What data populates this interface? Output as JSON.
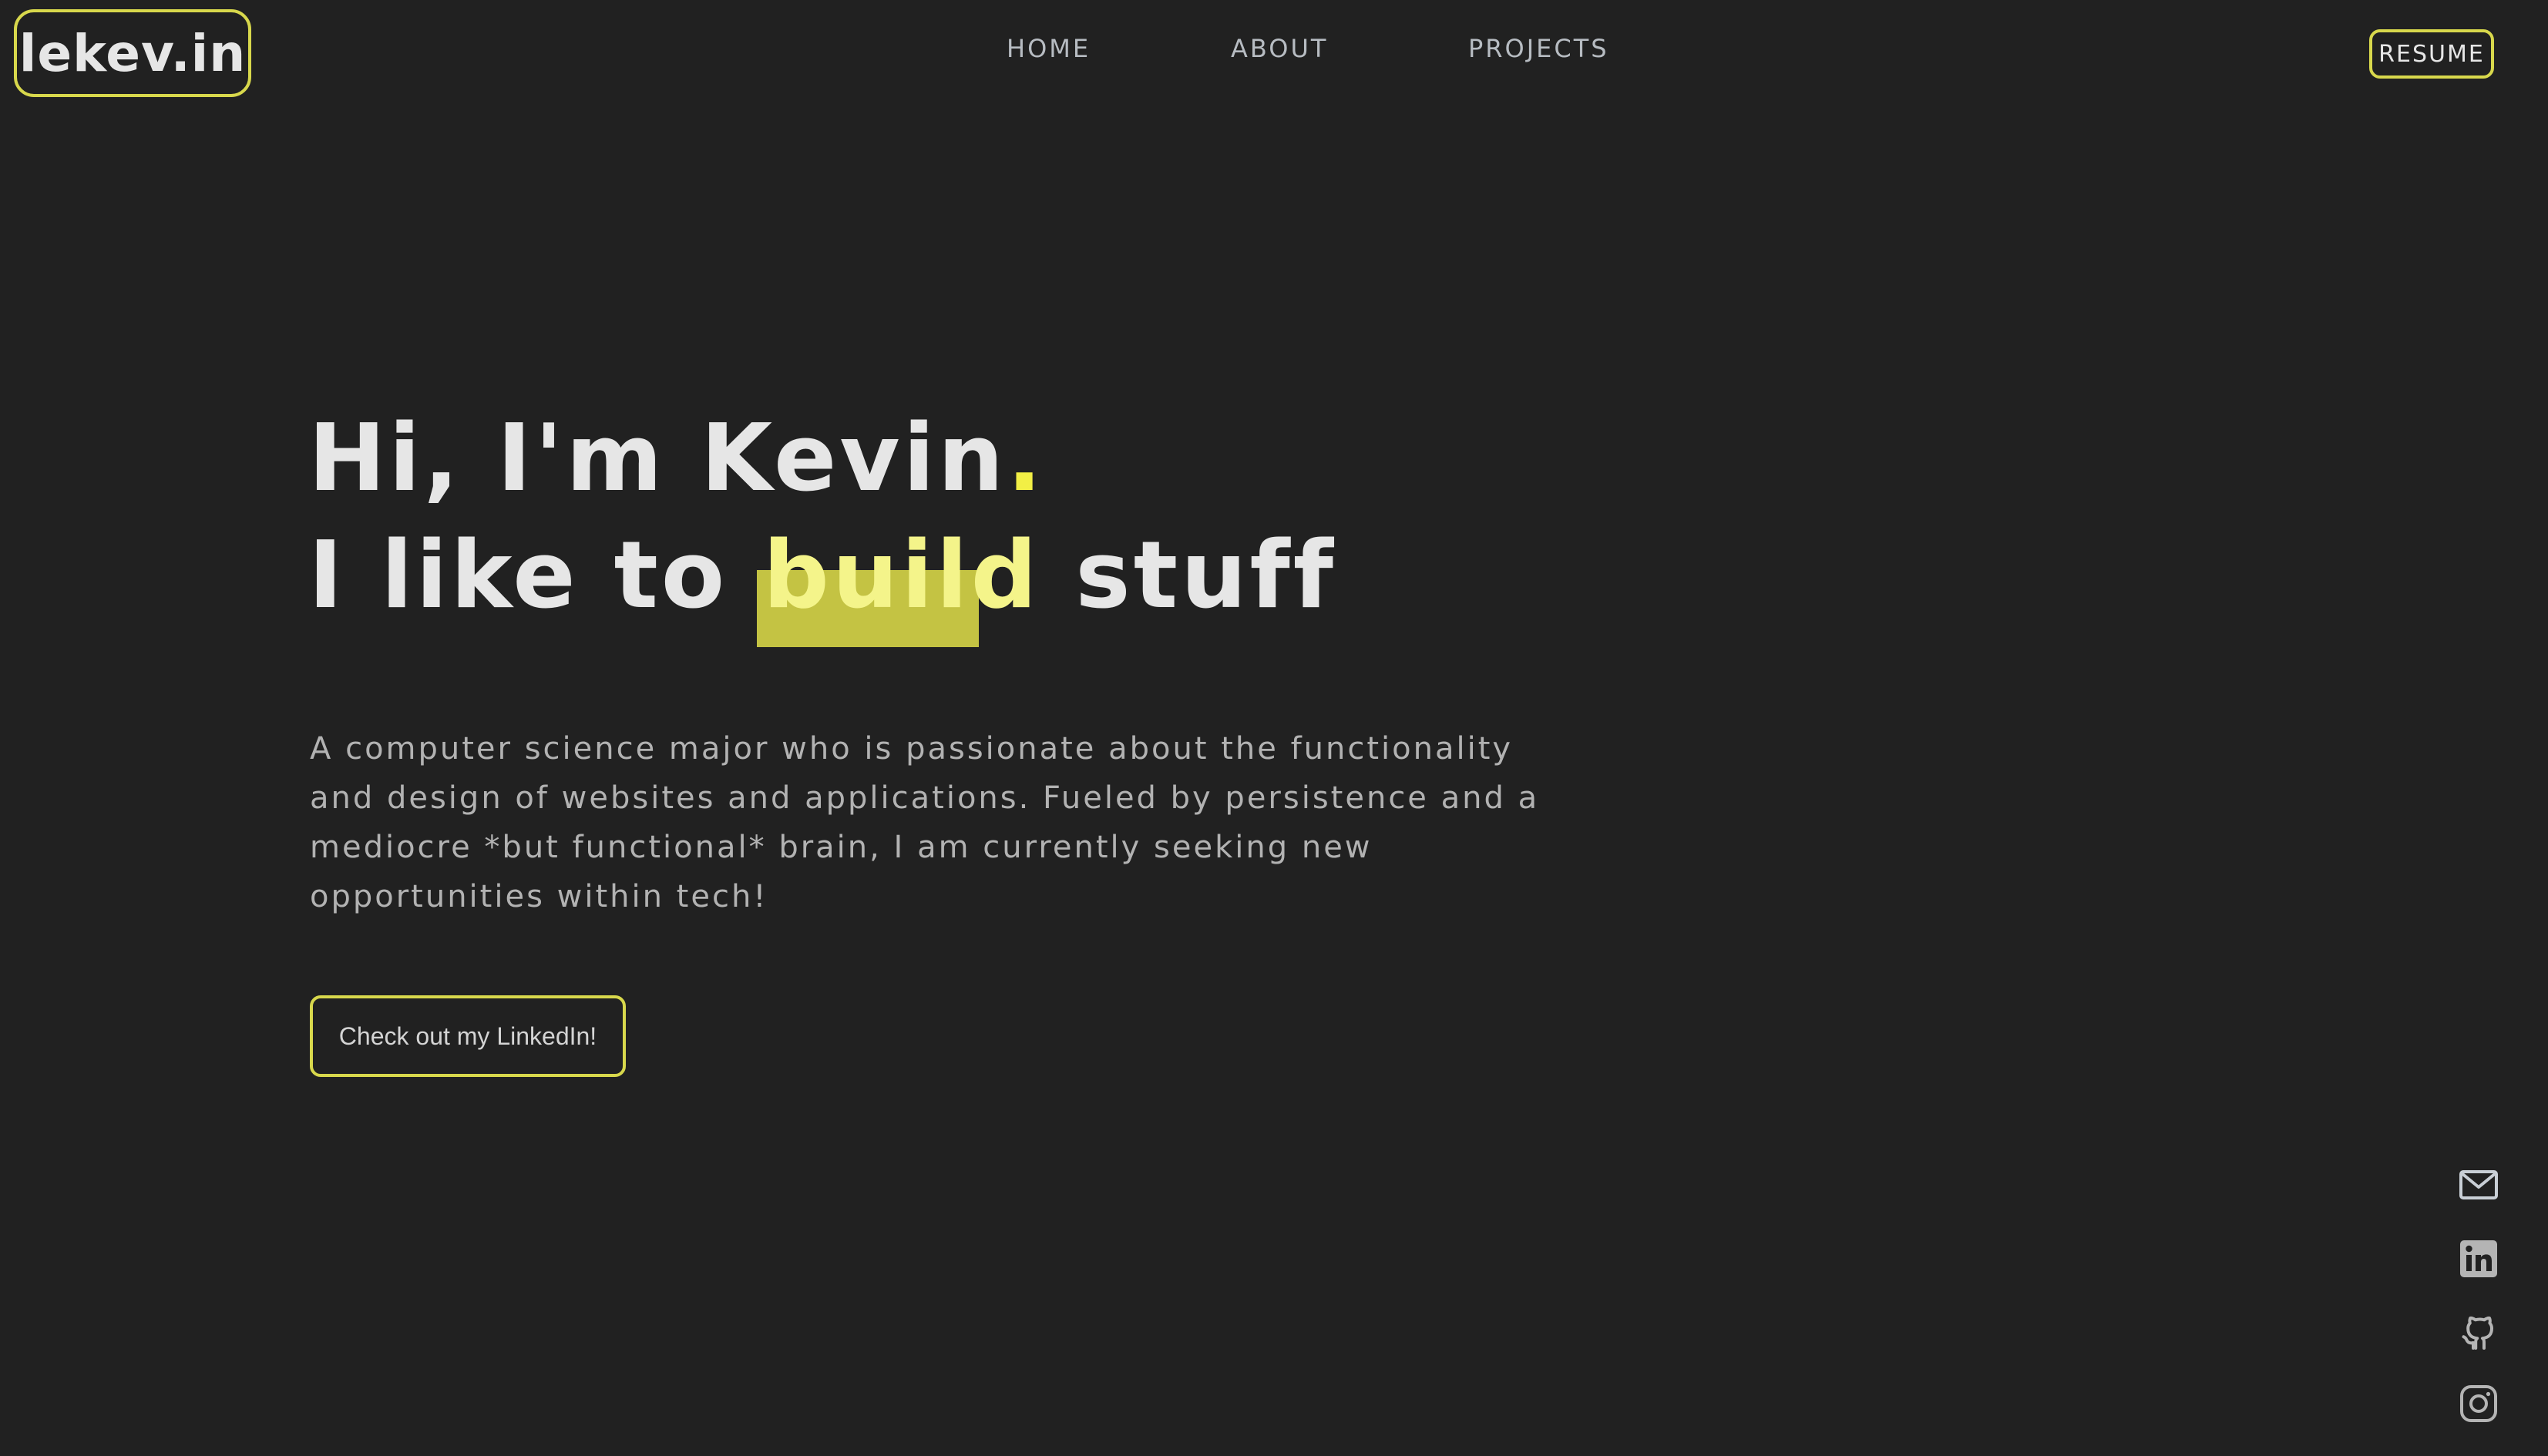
{
  "header": {
    "logo_text": "lekev.in",
    "nav": [
      {
        "label": "HOME"
      },
      {
        "label": "ABOUT"
      },
      {
        "label": "PROJECTS"
      }
    ],
    "resume_label": "RESUME"
  },
  "hero": {
    "line1": "Hi, I'm Kevin",
    "line1_dot": ".",
    "line2_prefix": "I like to ",
    "line2_highlight": "build",
    "line2_suffix": " stuff",
    "description": "A computer science major who is passionate about the functionality and design of websites and applications. Fueled by persistence and a mediocre *but functional* brain, I am currently seeking new opportunities within tech!",
    "cta_label": "Check out my LinkedIn!"
  },
  "social": [
    {
      "icon": "mail-icon"
    },
    {
      "icon": "linkedin-icon"
    },
    {
      "icon": "github-icon"
    },
    {
      "icon": "instagram-icon"
    }
  ],
  "colors": {
    "background": "#212121",
    "accent": "#d8d84c",
    "highlight": "#c4c343",
    "text": "#e6e6e6",
    "muted": "#b2b2b2"
  }
}
